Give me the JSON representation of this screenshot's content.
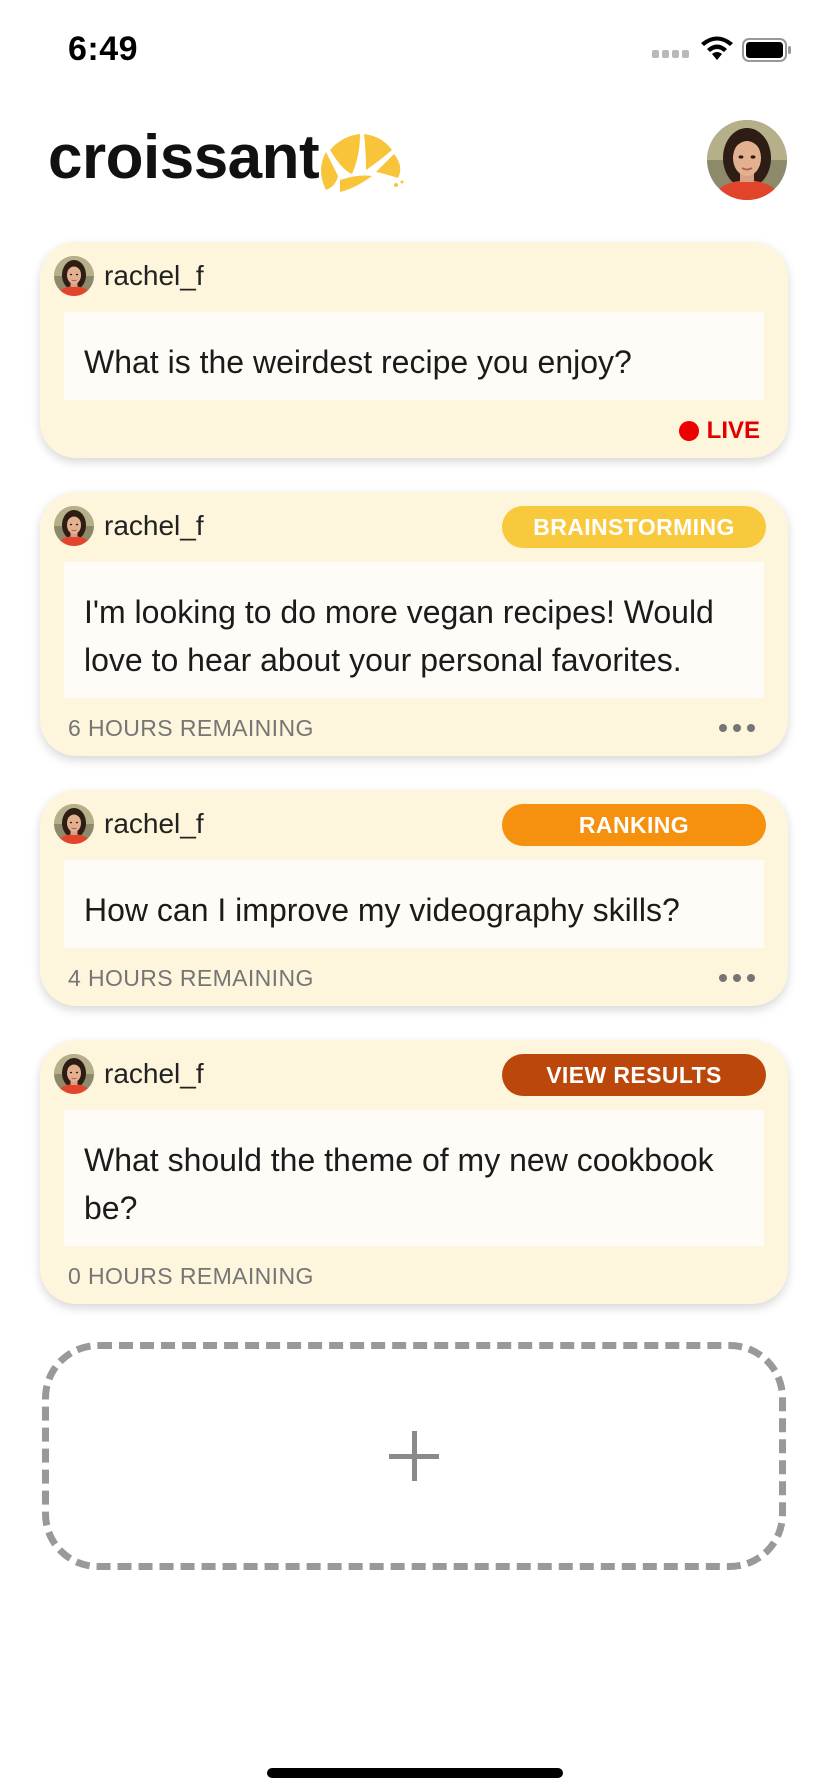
{
  "status_bar": {
    "time": "6:49",
    "icons": [
      "signal-icon",
      "wifi-icon",
      "battery-icon"
    ]
  },
  "header": {
    "app_title": "croissant",
    "logo_icon": "croissant-icon",
    "profile_icon": "avatar"
  },
  "colors": {
    "card_bg": "#fdf5dc",
    "live": "#e10000",
    "brainstorming": "#f9c93d",
    "ranking": "#f6910f",
    "view_results": "#bc470b"
  },
  "cards": [
    {
      "username": "rachel_f",
      "question": "What is the weirdest recipe you enjoy?",
      "status": "LIVE"
    },
    {
      "username": "rachel_f",
      "question": "I'm looking to do more vegan recipes! Would love to hear about your personal favorites.",
      "badge": "BRAINSTORMING",
      "remaining": "6 HOURS REMAINING",
      "menu_icon": "more-icon"
    },
    {
      "username": "rachel_f",
      "question": "How can I improve my videography skills?",
      "badge": "RANKING",
      "remaining": "4 HOURS REMAINING",
      "menu_icon": "more-icon"
    },
    {
      "username": "rachel_f",
      "question": "What should the theme of my new cookbook be?",
      "badge": "VIEW RESULTS",
      "remaining": "0 HOURS REMAINING"
    }
  ],
  "add_card": {
    "icon": "plus-icon"
  }
}
